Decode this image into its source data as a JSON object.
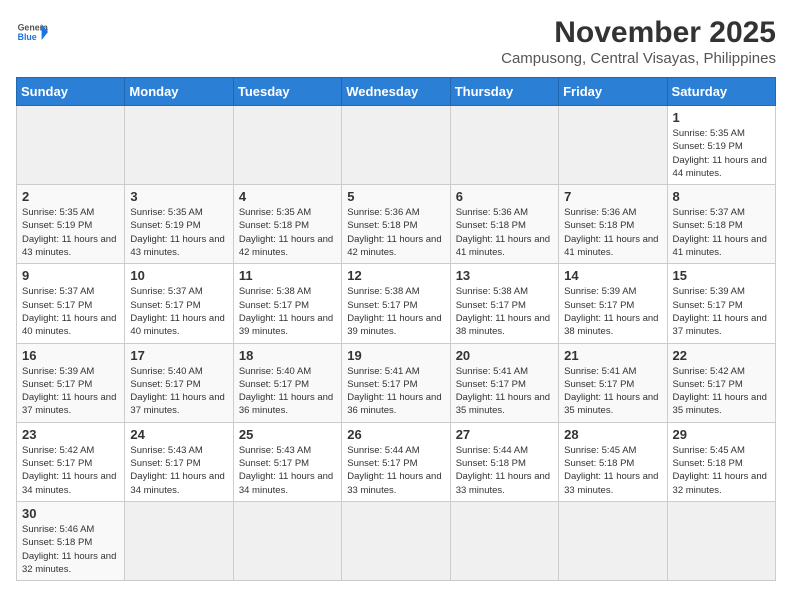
{
  "header": {
    "logo_general": "General",
    "logo_blue": "Blue",
    "title": "November 2025",
    "subtitle": "Campusong, Central Visayas, Philippines"
  },
  "columns": [
    "Sunday",
    "Monday",
    "Tuesday",
    "Wednesday",
    "Thursday",
    "Friday",
    "Saturday"
  ],
  "weeks": [
    {
      "days": [
        {
          "num": "",
          "info": "",
          "empty": true
        },
        {
          "num": "",
          "info": "",
          "empty": true
        },
        {
          "num": "",
          "info": "",
          "empty": true
        },
        {
          "num": "",
          "info": "",
          "empty": true
        },
        {
          "num": "",
          "info": "",
          "empty": true
        },
        {
          "num": "",
          "info": "",
          "empty": true
        },
        {
          "num": "1",
          "info": "Sunrise: 5:35 AM\nSunset: 5:19 PM\nDaylight: 11 hours and 44 minutes."
        }
      ]
    },
    {
      "days": [
        {
          "num": "2",
          "info": "Sunrise: 5:35 AM\nSunset: 5:19 PM\nDaylight: 11 hours and 43 minutes."
        },
        {
          "num": "3",
          "info": "Sunrise: 5:35 AM\nSunset: 5:19 PM\nDaylight: 11 hours and 43 minutes."
        },
        {
          "num": "4",
          "info": "Sunrise: 5:35 AM\nSunset: 5:18 PM\nDaylight: 11 hours and 42 minutes."
        },
        {
          "num": "5",
          "info": "Sunrise: 5:36 AM\nSunset: 5:18 PM\nDaylight: 11 hours and 42 minutes."
        },
        {
          "num": "6",
          "info": "Sunrise: 5:36 AM\nSunset: 5:18 PM\nDaylight: 11 hours and 41 minutes."
        },
        {
          "num": "7",
          "info": "Sunrise: 5:36 AM\nSunset: 5:18 PM\nDaylight: 11 hours and 41 minutes."
        },
        {
          "num": "8",
          "info": "Sunrise: 5:37 AM\nSunset: 5:18 PM\nDaylight: 11 hours and 41 minutes."
        }
      ]
    },
    {
      "days": [
        {
          "num": "9",
          "info": "Sunrise: 5:37 AM\nSunset: 5:17 PM\nDaylight: 11 hours and 40 minutes."
        },
        {
          "num": "10",
          "info": "Sunrise: 5:37 AM\nSunset: 5:17 PM\nDaylight: 11 hours and 40 minutes."
        },
        {
          "num": "11",
          "info": "Sunrise: 5:38 AM\nSunset: 5:17 PM\nDaylight: 11 hours and 39 minutes."
        },
        {
          "num": "12",
          "info": "Sunrise: 5:38 AM\nSunset: 5:17 PM\nDaylight: 11 hours and 39 minutes."
        },
        {
          "num": "13",
          "info": "Sunrise: 5:38 AM\nSunset: 5:17 PM\nDaylight: 11 hours and 38 minutes."
        },
        {
          "num": "14",
          "info": "Sunrise: 5:39 AM\nSunset: 5:17 PM\nDaylight: 11 hours and 38 minutes."
        },
        {
          "num": "15",
          "info": "Sunrise: 5:39 AM\nSunset: 5:17 PM\nDaylight: 11 hours and 37 minutes."
        }
      ]
    },
    {
      "days": [
        {
          "num": "16",
          "info": "Sunrise: 5:39 AM\nSunset: 5:17 PM\nDaylight: 11 hours and 37 minutes."
        },
        {
          "num": "17",
          "info": "Sunrise: 5:40 AM\nSunset: 5:17 PM\nDaylight: 11 hours and 37 minutes."
        },
        {
          "num": "18",
          "info": "Sunrise: 5:40 AM\nSunset: 5:17 PM\nDaylight: 11 hours and 36 minutes."
        },
        {
          "num": "19",
          "info": "Sunrise: 5:41 AM\nSunset: 5:17 PM\nDaylight: 11 hours and 36 minutes."
        },
        {
          "num": "20",
          "info": "Sunrise: 5:41 AM\nSunset: 5:17 PM\nDaylight: 11 hours and 35 minutes."
        },
        {
          "num": "21",
          "info": "Sunrise: 5:41 AM\nSunset: 5:17 PM\nDaylight: 11 hours and 35 minutes."
        },
        {
          "num": "22",
          "info": "Sunrise: 5:42 AM\nSunset: 5:17 PM\nDaylight: 11 hours and 35 minutes."
        }
      ]
    },
    {
      "days": [
        {
          "num": "23",
          "info": "Sunrise: 5:42 AM\nSunset: 5:17 PM\nDaylight: 11 hours and 34 minutes."
        },
        {
          "num": "24",
          "info": "Sunrise: 5:43 AM\nSunset: 5:17 PM\nDaylight: 11 hours and 34 minutes."
        },
        {
          "num": "25",
          "info": "Sunrise: 5:43 AM\nSunset: 5:17 PM\nDaylight: 11 hours and 34 minutes."
        },
        {
          "num": "26",
          "info": "Sunrise: 5:44 AM\nSunset: 5:17 PM\nDaylight: 11 hours and 33 minutes."
        },
        {
          "num": "27",
          "info": "Sunrise: 5:44 AM\nSunset: 5:18 PM\nDaylight: 11 hours and 33 minutes."
        },
        {
          "num": "28",
          "info": "Sunrise: 5:45 AM\nSunset: 5:18 PM\nDaylight: 11 hours and 33 minutes."
        },
        {
          "num": "29",
          "info": "Sunrise: 5:45 AM\nSunset: 5:18 PM\nDaylight: 11 hours and 32 minutes."
        }
      ]
    },
    {
      "days": [
        {
          "num": "30",
          "info": "Sunrise: 5:46 AM\nSunset: 5:18 PM\nDaylight: 11 hours and 32 minutes."
        },
        {
          "num": "",
          "info": "",
          "empty": true
        },
        {
          "num": "",
          "info": "",
          "empty": true
        },
        {
          "num": "",
          "info": "",
          "empty": true
        },
        {
          "num": "",
          "info": "",
          "empty": true
        },
        {
          "num": "",
          "info": "",
          "empty": true
        },
        {
          "num": "",
          "info": "",
          "empty": true
        }
      ]
    }
  ]
}
